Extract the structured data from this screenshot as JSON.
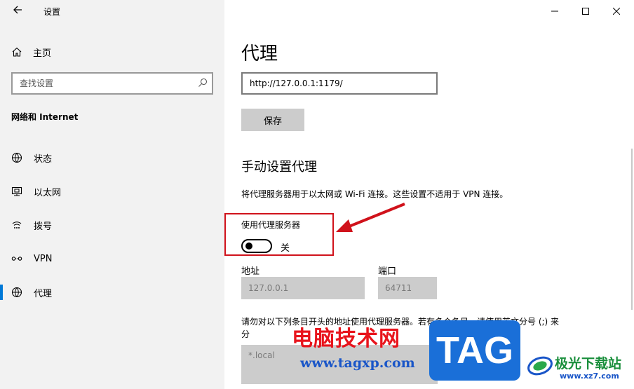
{
  "window": {
    "title": "设置",
    "back_icon": "back-arrow-icon",
    "controls": [
      "minimize",
      "maximize",
      "close"
    ]
  },
  "sidebar": {
    "home_label": "主页",
    "search_placeholder": "查找设置",
    "section_title": "网络和 Internet",
    "items": [
      {
        "label": "状态",
        "icon": "globe-status-icon",
        "selected": false
      },
      {
        "label": "以太网",
        "icon": "ethernet-icon",
        "selected": false
      },
      {
        "label": "拨号",
        "icon": "dialup-icon",
        "selected": false
      },
      {
        "label": "VPN",
        "icon": "vpn-icon",
        "selected": false
      },
      {
        "label": "代理",
        "icon": "globe-icon",
        "selected": true
      }
    ]
  },
  "main": {
    "title": "代理",
    "script_url_value": "http://127.0.0.1:1179/",
    "save_label": "保存",
    "manual_title": "手动设置代理",
    "manual_desc": "将代理服务器用于以太网或 Wi-Fi 连接。这些设置不适用于 VPN 连接。",
    "use_proxy_label": "使用代理服务器",
    "use_proxy_state": "关",
    "use_proxy_on": false,
    "address_label": "地址",
    "address_value": "127.0.0.1",
    "port_label": "端口",
    "port_value": "64711",
    "exceptions_desc": "请勿对以下列条目开头的地址使用代理服务器。若有多个条目，请使用英文分号 (;) 来分",
    "exceptions_value": "*.local"
  },
  "annotation": {
    "highlight_color": "#d0121b"
  },
  "watermark": {
    "cn_text": "电脑技术网",
    "url": "www.tagxp.com",
    "tag": "TAG",
    "site_cn": "极光下载站",
    "site_url": "www.xz7.com"
  },
  "colors": {
    "accent": "#0078d7",
    "sidebar_bg": "#f2f2f2",
    "button_bg": "#cccccc"
  }
}
